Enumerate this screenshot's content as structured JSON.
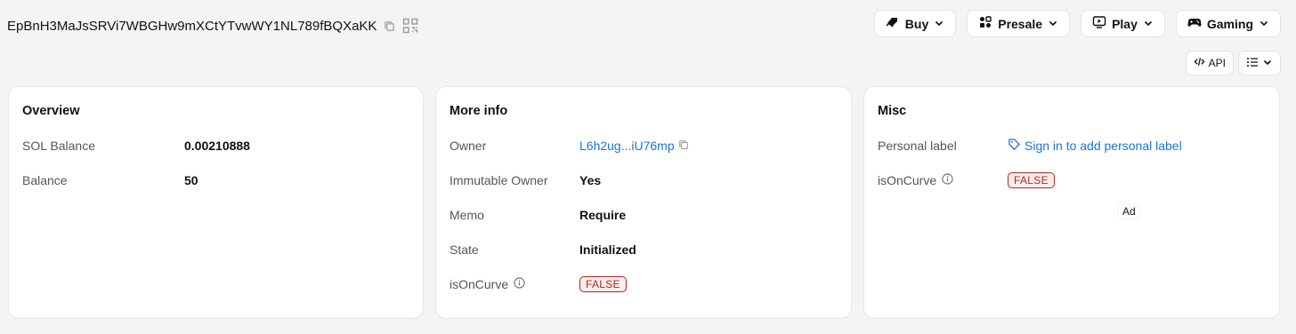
{
  "address": {
    "value": "EpBnH3MaJsSRVi7WBGHw9mXCtYTvwWY1NL789fBQXaKK",
    "copy_icon": "copy-icon",
    "qr_icon": "qr-code-icon"
  },
  "nav": {
    "buttons": [
      {
        "label": "Buy",
        "icon": "buy-icon"
      },
      {
        "label": "Presale",
        "icon": "presale-icon"
      },
      {
        "label": "Play",
        "icon": "play-icon"
      },
      {
        "label": "Gaming",
        "icon": "gamepad-icon"
      }
    ]
  },
  "toolbar": {
    "api_label": "API",
    "menu_icon": "list-icon"
  },
  "overview": {
    "title": "Overview",
    "rows": [
      {
        "key": "SOL Balance",
        "value": "0.00210888"
      },
      {
        "key": "Balance",
        "value": "50"
      }
    ]
  },
  "more_info": {
    "title": "More info",
    "rows": [
      {
        "key": "Owner",
        "value": "L6h2ug...iU76mp"
      },
      {
        "key": "Immutable Owner",
        "value": "Yes"
      },
      {
        "key": "Memo",
        "value": "Require"
      },
      {
        "key": "State",
        "value": "Initialized"
      },
      {
        "key": "isOnCurve",
        "value": "FALSE"
      }
    ]
  },
  "misc": {
    "title": "Misc",
    "rows": [
      {
        "key": "Personal label",
        "value": "Sign in to add personal label"
      },
      {
        "key": "isOnCurve",
        "value": "FALSE"
      }
    ],
    "ad_label": "Ad"
  },
  "colors": {
    "link": "#1a73e8",
    "badge_red": "#b3261e",
    "background": "#f4f4f4"
  }
}
